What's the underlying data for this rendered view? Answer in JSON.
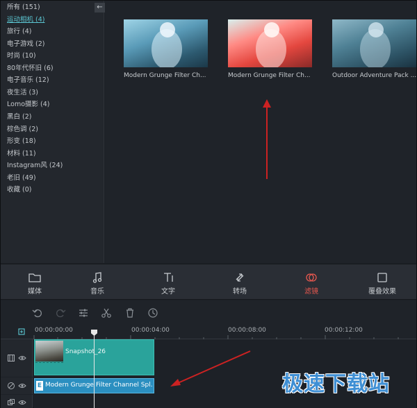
{
  "sidebar": {
    "categories": [
      {
        "label": "所有 (151)"
      },
      {
        "label": "运动相机 (4)"
      },
      {
        "label": "旅行 (4)"
      },
      {
        "label": "电子游戏 (2)"
      },
      {
        "label": "时尚 (10)"
      },
      {
        "label": "80年代怀旧 (6)"
      },
      {
        "label": "电子音乐 (12)"
      },
      {
        "label": "夜生活 (3)"
      },
      {
        "label": "Lomo摄影 (4)"
      },
      {
        "label": "黑白 (2)"
      },
      {
        "label": "棕色调 (2)"
      },
      {
        "label": "形变 (18)"
      },
      {
        "label": "材料 (11)"
      },
      {
        "label": "Instagram风 (24)"
      },
      {
        "label": "老旧 (49)"
      },
      {
        "label": "收藏 (0)"
      }
    ],
    "active_index": 1,
    "collapse_icon": "arrow-left-icon"
  },
  "thumbnails": [
    {
      "caption": "Modern Grunge Filter Ch..."
    },
    {
      "caption": "Modern Grunge Filter Ch..."
    },
    {
      "caption": "Outdoor Adventure Pack ..."
    }
  ],
  "tabs": [
    {
      "label": "媒体",
      "icon": "folder-icon"
    },
    {
      "label": "音乐",
      "icon": "music-note-icon"
    },
    {
      "label": "文字",
      "icon": "text-icon"
    },
    {
      "label": "转场",
      "icon": "transition-icon"
    },
    {
      "label": "滤镜",
      "icon": "filter-icon",
      "active": true
    },
    {
      "label": "覆叠效果",
      "icon": "overlay-icon"
    }
  ],
  "colors": {
    "accent": "#5cc8d4",
    "active_tab": "#e8584f",
    "video_clip": "#2aa39b",
    "filter_clip": "#2b8fc0",
    "annotation_arrow": "#cc2222"
  },
  "timeline": {
    "ticks": [
      "00:00:00:00",
      "00:00:04:00",
      "00:00:08:00",
      "00:00:12:00"
    ],
    "video_clip_label": "Snapshot_26",
    "filter_clip_label": "Modern Grunge Filter Channel Spl..."
  },
  "watermark": "极速下载站"
}
